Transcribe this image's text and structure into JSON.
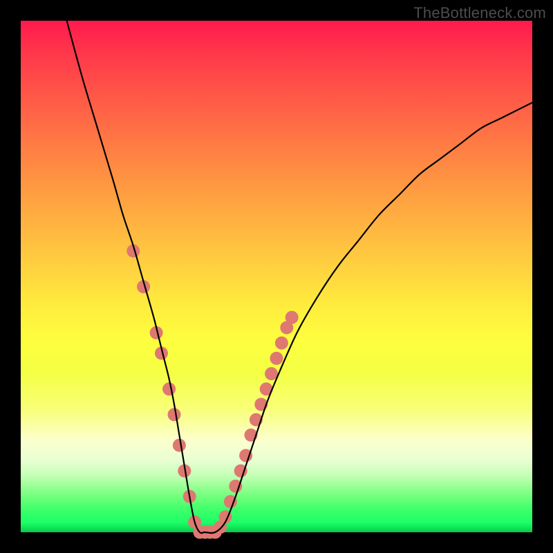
{
  "watermark": "TheBottleneck.com",
  "chart_data": {
    "type": "line",
    "title": "",
    "xlabel": "",
    "ylabel": "",
    "ylim": [
      0,
      100
    ],
    "xlim": [
      0,
      100
    ],
    "series": [
      {
        "name": "curve",
        "x": [
          9,
          12,
          15,
          18,
          20,
          22,
          24,
          26,
          27,
          28,
          29,
          30,
          31,
          32,
          33,
          34,
          35,
          36,
          38,
          40,
          42,
          44,
          46,
          48,
          50,
          54,
          58,
          62,
          66,
          70,
          74,
          78,
          82,
          86,
          90,
          94,
          98,
          100
        ],
        "values": [
          100,
          89,
          79,
          69,
          62,
          56,
          49,
          42,
          38,
          34,
          30,
          25,
          19,
          13,
          7,
          2,
          0,
          0,
          0,
          2,
          7,
          13,
          19,
          25,
          30,
          39,
          46,
          52,
          57,
          62,
          66,
          70,
          73,
          76,
          79,
          81,
          83,
          84
        ]
      }
    ],
    "markers": [
      {
        "x": 22,
        "y": 55
      },
      {
        "x": 24,
        "y": 48
      },
      {
        "x": 26.5,
        "y": 39
      },
      {
        "x": 27.5,
        "y": 35
      },
      {
        "x": 29,
        "y": 28
      },
      {
        "x": 30,
        "y": 23
      },
      {
        "x": 31,
        "y": 17
      },
      {
        "x": 32,
        "y": 12
      },
      {
        "x": 33,
        "y": 7
      },
      {
        "x": 34,
        "y": 2
      },
      {
        "x": 35,
        "y": 0
      },
      {
        "x": 36,
        "y": 0
      },
      {
        "x": 37,
        "y": 0
      },
      {
        "x": 38,
        "y": 0
      },
      {
        "x": 39,
        "y": 1
      },
      {
        "x": 40,
        "y": 3
      },
      {
        "x": 41,
        "y": 6
      },
      {
        "x": 42,
        "y": 9
      },
      {
        "x": 43,
        "y": 12
      },
      {
        "x": 44,
        "y": 15
      },
      {
        "x": 45,
        "y": 19
      },
      {
        "x": 46,
        "y": 22
      },
      {
        "x": 47,
        "y": 25
      },
      {
        "x": 48,
        "y": 28
      },
      {
        "x": 49,
        "y": 31
      },
      {
        "x": 50,
        "y": 34
      },
      {
        "x": 51,
        "y": 37
      },
      {
        "x": 52,
        "y": 40
      },
      {
        "x": 53,
        "y": 42
      }
    ],
    "marker_color": "#de7871",
    "curve_color": "#000000"
  }
}
